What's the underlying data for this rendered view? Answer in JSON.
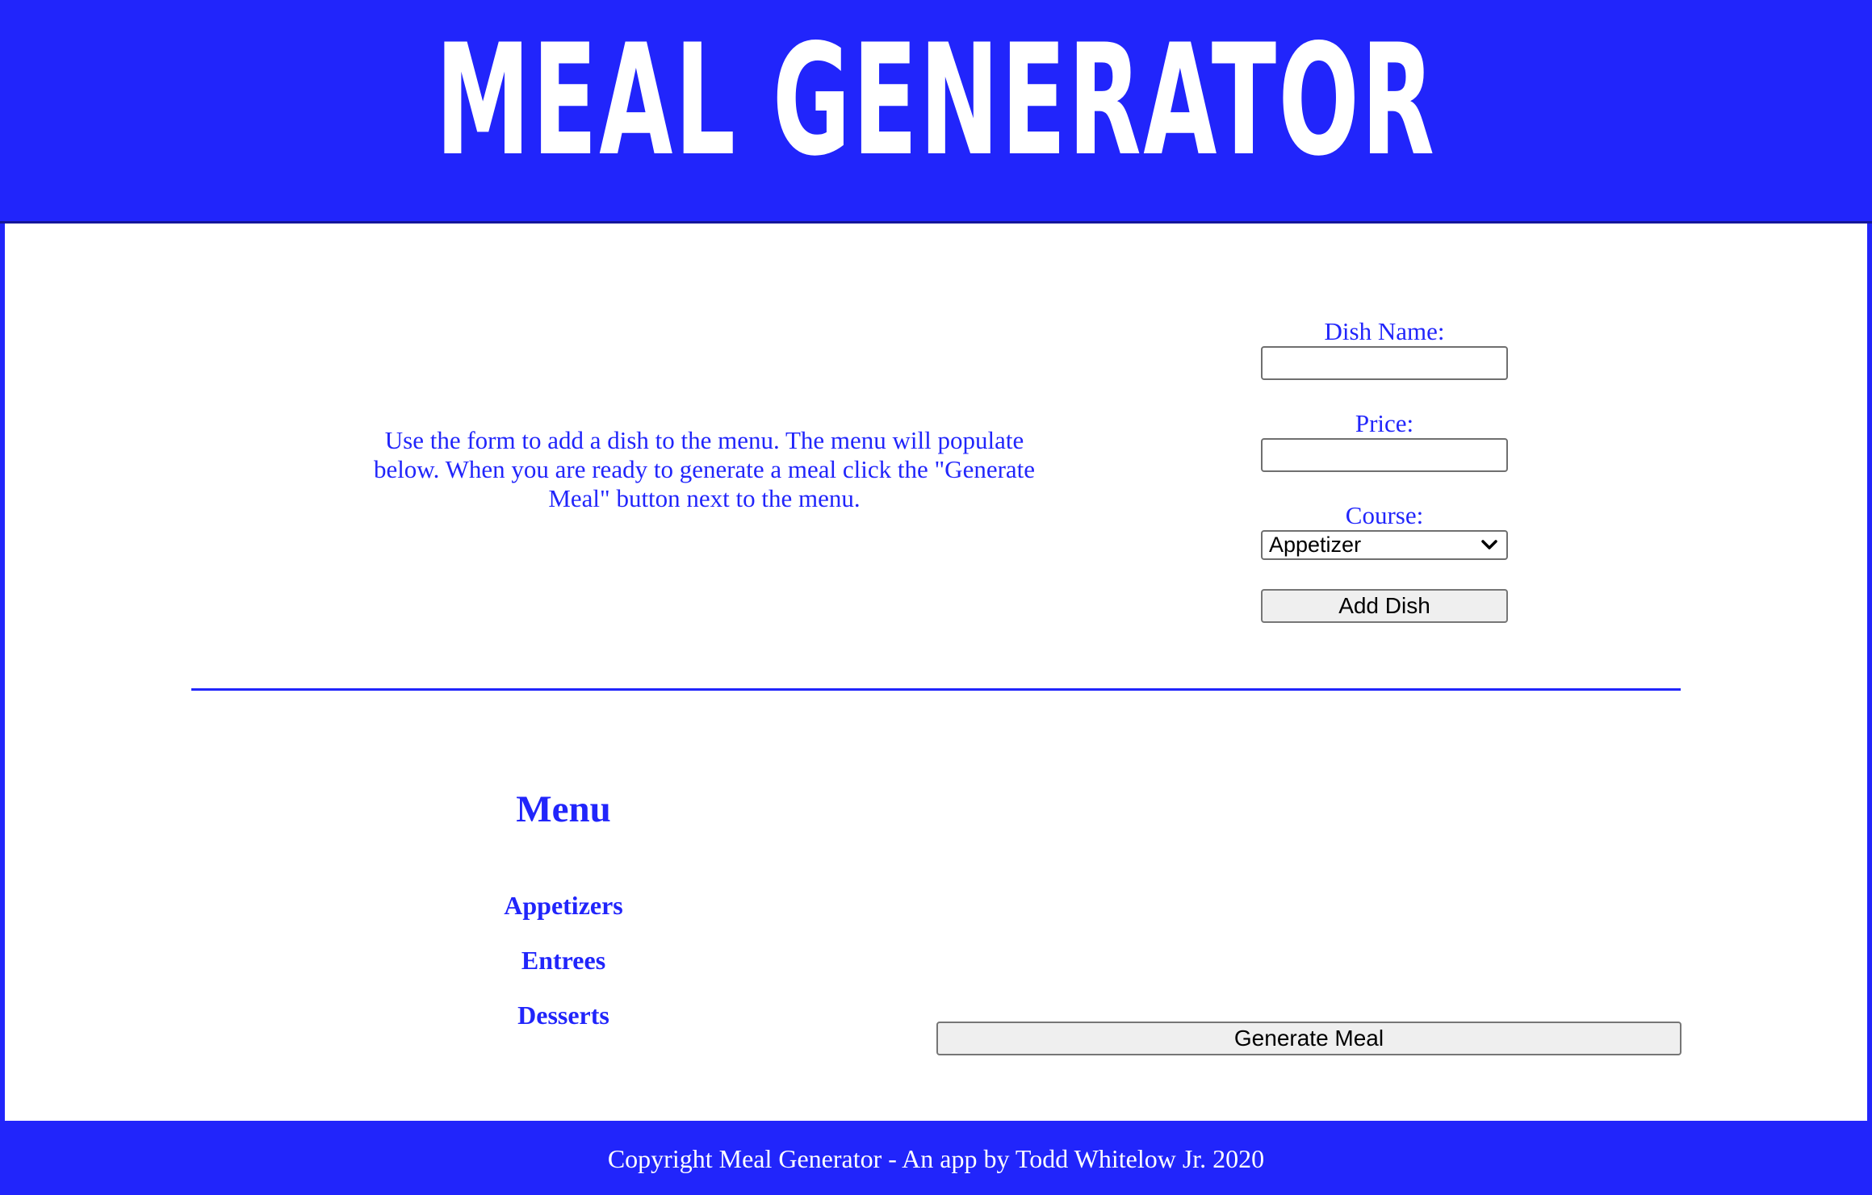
{
  "header": {
    "title": "MEAL GENERATOR"
  },
  "intro": {
    "text": "Use the form to add a dish to the menu. The menu will populate below. When you are ready to generate a meal click the \"Generate Meal\" button next to the menu."
  },
  "form": {
    "dish_name_label": "Dish Name:",
    "dish_name_value": "",
    "price_label": "Price:",
    "price_value": "",
    "course_label": "Course:",
    "course_selected": "Appetizer",
    "add_button_label": "Add Dish"
  },
  "menu": {
    "title": "Menu",
    "categories": [
      "Appetizers",
      "Entrees",
      "Desserts"
    ]
  },
  "generate_button_label": "Generate Meal",
  "footer": {
    "text": "Copyright Meal Generator - An app by Todd Whitelow Jr. 2020"
  },
  "colors": {
    "brand_blue": "#2125fb",
    "text_white": "#ffffff"
  },
  "icons": {
    "course_select": "chevron-down-icon"
  }
}
